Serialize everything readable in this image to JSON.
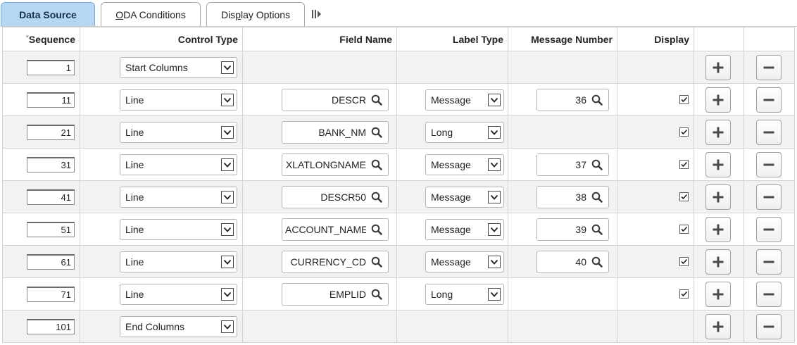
{
  "tabs": [
    {
      "label": "Data Source",
      "active": true
    },
    {
      "label": "ODA Conditions",
      "active": false,
      "mnemonic": "O"
    },
    {
      "label": "Display Options",
      "active": false,
      "mnemonic": "p"
    }
  ],
  "tab_more_icon": "show-all-tabs-icon",
  "columns": {
    "sequence": "Sequence",
    "required_marker": "*",
    "control_type": "Control Type",
    "field_name": "Field Name",
    "label_type": "Label Type",
    "message_number": "Message Number",
    "display": "Display"
  },
  "rows": [
    {
      "sequence": "1",
      "control_type": "Start Columns",
      "field_name": null,
      "label_type": null,
      "message_number": null,
      "display": null
    },
    {
      "sequence": "11",
      "control_type": "Line",
      "field_name": "DESCR",
      "label_type": "Message",
      "message_number": "36",
      "display": true
    },
    {
      "sequence": "21",
      "control_type": "Line",
      "field_name": "BANK_NM",
      "label_type": "Long",
      "message_number": null,
      "display": true
    },
    {
      "sequence": "31",
      "control_type": "Line",
      "field_name": "XLATLONGNAME",
      "label_type": "Message",
      "message_number": "37",
      "display": true
    },
    {
      "sequence": "41",
      "control_type": "Line",
      "field_name": "DESCR50",
      "label_type": "Message",
      "message_number": "38",
      "display": true
    },
    {
      "sequence": "51",
      "control_type": "Line",
      "field_name": "ACCOUNT_NAME",
      "label_type": "Message",
      "message_number": "39",
      "display": true
    },
    {
      "sequence": "61",
      "control_type": "Line",
      "field_name": "CURRENCY_CD",
      "label_type": "Message",
      "message_number": "40",
      "display": true
    },
    {
      "sequence": "71",
      "control_type": "Line",
      "field_name": "EMPLID",
      "label_type": "Long",
      "message_number": null,
      "display": true
    },
    {
      "sequence": "101",
      "control_type": "End Columns",
      "field_name": null,
      "label_type": null,
      "message_number": null,
      "display": null
    }
  ],
  "icons": {
    "dropdown": "chevron-down-icon",
    "lookup": "magnifier-icon",
    "add": "plus-icon",
    "delete": "minus-icon",
    "checkbox": "checkmark-icon"
  },
  "colors": {
    "active_tab_bg": "#b6d7f4",
    "alt_row_bg": "#f2f2f2",
    "grid_border": "#d3d3d3"
  }
}
